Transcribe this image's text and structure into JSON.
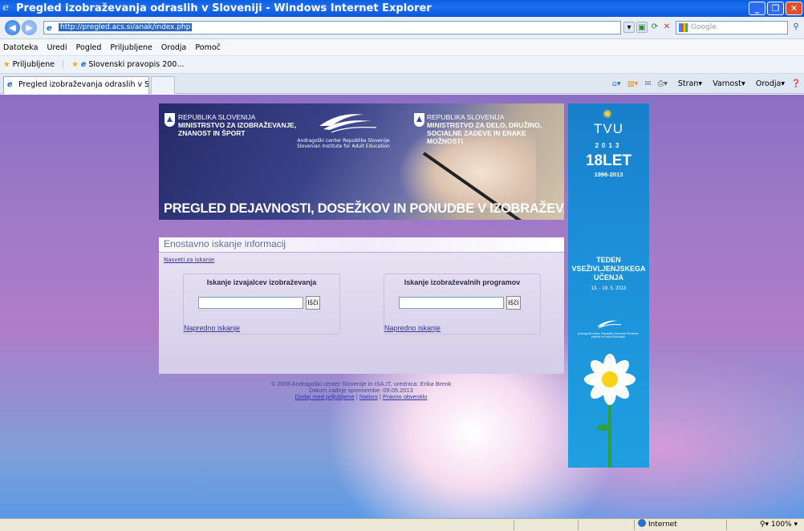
{
  "window": {
    "title": "Pregled izobraževanja odraslih v Sloveniji - Windows Internet Explorer",
    "address": "http://pregled.acs.si/anak/index.php",
    "search_placeholder": "Google"
  },
  "menu": [
    "Datoteka",
    "Uredi",
    "Pogled",
    "Priljubljene",
    "Orodja",
    "Pomoč"
  ],
  "favorites": {
    "label": "Priljubljene",
    "items": [
      "Slovenski pravopis 200..."
    ]
  },
  "tab": {
    "label": "Pregled izobraževanja odraslih v Sloveniji"
  },
  "commandbar": {
    "page": "Stran",
    "safety": "Varnost",
    "tools": "Orodja"
  },
  "banner": {
    "left_rep": "REPUBLIKA SLOVENIJA",
    "left_ministry": "MINISTRSTVO ZA IZOBRAŽEVANJE, ZNANOST IN ŠPORT",
    "center_logo_text": "Andragoški center Republike Slovenije",
    "center_logo_sub": "Slovenian Institute for Adult Education",
    "right_rep": "REPUBLIKA SLOVENIJA",
    "right_ministry": "MINISTRSTVO ZA DELO, DRUŽINO, SOCIALNE ZADEVE IN ENAKE MOŽNOSTI",
    "title": "PREGLED DEJAVNOSTI, DOSEŽKOV IN PONUDBE V IZOBRAŽEVANJU ODRASLIH"
  },
  "search": {
    "title": "Enostavno iskanje informacij",
    "hint": "Nasveti za iskanje",
    "providers": {
      "title": "Iskanje izvajalcev izobraževanja",
      "button": "Išči",
      "advanced": "Napredno iskanje",
      "value": ""
    },
    "programs": {
      "title": "Iskanje izobraževalnih programov",
      "button": "Išči",
      "advanced": "Napredno iskanje",
      "value": ""
    }
  },
  "footer": {
    "line1": "© 2008 Andragoški center Slovenije in ISA.IT, urednica: Erika Brenk",
    "line2": "Datum zadnje spremembe: 09.05.2013",
    "link_fav": "Dodaj med priljubljene",
    "link_print": "Natisni",
    "link_legal": "Pravno obvestilo"
  },
  "side_ad": {
    "tvu": "TVU",
    "year": "2013",
    "anniv": "18LET",
    "range": "1996-2013",
    "teden": "TEDEN VSEŽIVLJENJSKEGA UČENJA",
    "dates": "13. - 19. 5. 2013",
    "mini_logo_text": "Andragoški center Republike Slovenije Slovenian Institute for Adult Education"
  },
  "status": {
    "zone": "Internet",
    "zoom": "100%"
  },
  "colors": {
    "titlebar": "#0a5fe0",
    "panel_title": "#5f6fb0",
    "side_blue": "#1c8fd8"
  }
}
